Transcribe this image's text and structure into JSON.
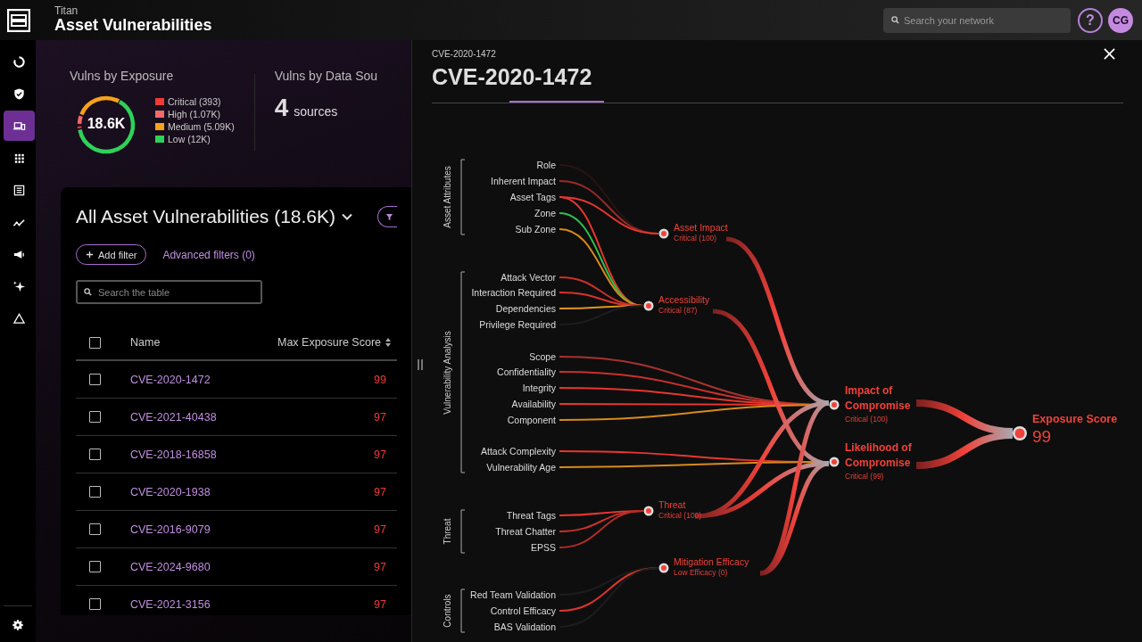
{
  "app": {
    "name": "Titan",
    "title": "Asset Vulnerabilities"
  },
  "header": {
    "search": {
      "placeholder": "Search your network"
    },
    "help": "?",
    "avatar": "CG"
  },
  "sidebar": {
    "items": [
      {
        "kind": "ring",
        "selected": false
      },
      {
        "kind": "shield",
        "selected": false
      },
      {
        "kind": "devices",
        "selected": true
      },
      {
        "kind": "grid",
        "selected": false
      },
      {
        "kind": "list",
        "selected": false
      },
      {
        "kind": "trend",
        "selected": false
      },
      {
        "kind": "megaphone",
        "selected": false
      },
      {
        "kind": "sparkle",
        "selected": false
      },
      {
        "kind": "triangle",
        "selected": false
      }
    ]
  },
  "summary": {
    "exposure": {
      "title": "Vulns by Exposure",
      "total": "18.6K",
      "legend": [
        {
          "label": "Critical (393)",
          "color": "#ef3b36"
        },
        {
          "label": "High (1.07K)",
          "color": "#f26a6a"
        },
        {
          "label": "Medium (5.09K)",
          "color": "#f7a21b"
        },
        {
          "label": "Low (12K)",
          "color": "#2fd158"
        }
      ]
    },
    "sources": {
      "title": "Vulns by Data Sou",
      "count": "4",
      "unit": "sources"
    }
  },
  "table": {
    "title": "All Asset Vulnerabilities (18.6K)",
    "add_filter": "Add filter",
    "advanced_filters": "Advanced filters (0)",
    "search": {
      "placeholder": "Search the table"
    },
    "all_checked": false,
    "columns": [
      "Name",
      "Max Exposure Score"
    ],
    "rows": [
      {
        "name": "CVE-2020-1472",
        "score": "99",
        "checked": false
      },
      {
        "name": "CVE-2021-40438",
        "score": "97",
        "checked": false
      },
      {
        "name": "CVE-2018-16858",
        "score": "97",
        "checked": false
      },
      {
        "name": "CVE-2020-1938",
        "score": "97",
        "checked": false
      },
      {
        "name": "CVE-2016-9079",
        "score": "97",
        "checked": false
      },
      {
        "name": "CVE-2024-9680",
        "score": "97",
        "checked": false
      },
      {
        "name": "CVE-2021-3156",
        "score": "97",
        "checked": false
      }
    ]
  },
  "drawer": {
    "breadcrumb": "CVE-2020-1472",
    "title": "CVE-2020-1472",
    "graph": {
      "groups": [
        {
          "label": "Asset Attributes",
          "factors": [
            {
              "label": "Role",
              "color": "#2a1414"
            },
            {
              "label": "Inherent Impact",
              "color": "#9c2a25"
            },
            {
              "label": "Asset Tags",
              "color": "#e8362f"
            },
            {
              "label": "Zone",
              "color": "#2fbf4f"
            },
            {
              "label": "Sub Zone",
              "color": "#d98a1c"
            }
          ]
        },
        {
          "label": "Vulnerability Analysis",
          "factors": [
            {
              "label": "Attack Vector",
              "color": "#c9302b"
            },
            {
              "label": "Interaction Required",
              "color": "#d9332d"
            },
            {
              "label": "Dependencies",
              "color": "#e3961f"
            },
            {
              "label": "Privilege Required",
              "color": "#1c1c1c"
            },
            {
              "label": "Scope",
              "color": "#a8322e"
            },
            {
              "label": "Confidentiality",
              "color": "#c9302b"
            },
            {
              "label": "Integrity",
              "color": "#e8362f"
            },
            {
              "label": "Availability",
              "color": "#e8362f"
            },
            {
              "label": "Component",
              "color": "#d98a1c"
            },
            {
              "label": "Attack Complexity",
              "color": "#e8362f"
            },
            {
              "label": "Vulnerability Age",
              "color": "#d98a1c"
            }
          ]
        },
        {
          "label": "Threat",
          "factors": [
            {
              "label": "Threat Tags",
              "color": "#e8362f"
            },
            {
              "label": "Threat Chatter",
              "color": "#c9302b"
            },
            {
              "label": "EPSS",
              "color": "#b02c28"
            }
          ]
        },
        {
          "label": "Controls",
          "factors": [
            {
              "label": "Red Team Validation",
              "color": "#1c1c1c"
            },
            {
              "label": "Control Efficacy",
              "color": "#d9332d"
            },
            {
              "label": "BAS Validation",
              "color": "#1c1c1c"
            }
          ]
        }
      ],
      "nodes": [
        {
          "label": "Asset Impact",
          "rating": "Critical (100)"
        },
        {
          "label": "Accessibility",
          "rating": "Critical (87)"
        },
        {
          "label": "Threat",
          "rating": "Critical (100)"
        },
        {
          "label": "Mitigation Efficacy",
          "rating": "Low Efficacy (0)"
        },
        {
          "label": "Impact of Compromise",
          "rating": "Critical (100)"
        },
        {
          "label": "Likelihood of Compromise",
          "rating": "Critical (99)"
        }
      ],
      "result": {
        "label": "Exposure Score",
        "value": "99"
      }
    }
  }
}
